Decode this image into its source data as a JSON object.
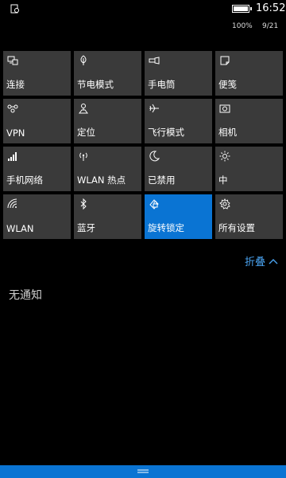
{
  "status": {
    "time": "16:52",
    "battery_pct_text": "100%",
    "battery_level": 1.0,
    "date": "9/21"
  },
  "tiles": [
    {
      "label": "连接",
      "icon": "project-screen-icon",
      "active": false
    },
    {
      "label": "节电模式",
      "icon": "battery-saver-leaf-icon",
      "active": false
    },
    {
      "label": "手电筒",
      "icon": "flashlight-icon",
      "active": false
    },
    {
      "label": "便笺",
      "icon": "note-icon",
      "active": false
    },
    {
      "label": "VPN",
      "icon": "vpn-icon",
      "active": false
    },
    {
      "label": "定位",
      "icon": "location-icon",
      "active": false
    },
    {
      "label": "飞行模式",
      "icon": "airplane-icon",
      "active": false
    },
    {
      "label": "相机",
      "icon": "camera-icon",
      "active": false
    },
    {
      "label": "手机网络",
      "icon": "cellular-signal-icon",
      "active": false
    },
    {
      "label": "WLAN 热点",
      "icon": "hotspot-icon",
      "active": false
    },
    {
      "label": "已禁用",
      "icon": "quiet-hours-moon-icon",
      "active": false
    },
    {
      "label": "中",
      "icon": "brightness-icon",
      "active": false
    },
    {
      "label": "WLAN",
      "icon": "wifi-icon",
      "active": false
    },
    {
      "label": "蓝牙",
      "icon": "bluetooth-icon",
      "active": false
    },
    {
      "label": "旋转锁定",
      "icon": "rotation-lock-icon",
      "active": true
    },
    {
      "label": "所有设置",
      "icon": "settings-gear-icon",
      "active": false
    }
  ],
  "collapse_label": "折叠",
  "notifications_empty": "无通知",
  "colors": {
    "accent": "#0a74d3",
    "tile": "#3a3a3a",
    "link": "#4aa3f0",
    "background": "#000000"
  }
}
